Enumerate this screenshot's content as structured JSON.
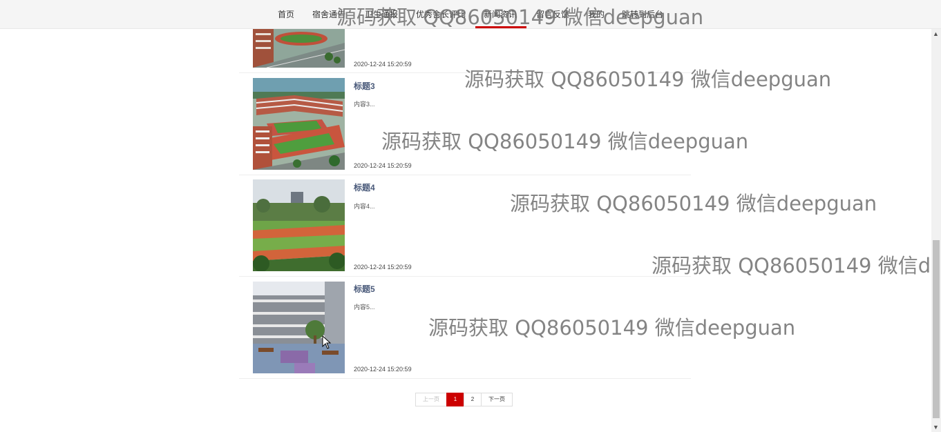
{
  "nav": {
    "items": [
      "首页",
      "宿舍通告",
      "卫生通报",
      "优秀舍长评比",
      "新闻资讯",
      "留言反馈",
      "我的",
      "跳转到后台"
    ],
    "active": "新闻资讯"
  },
  "news": [
    {
      "title": "",
      "summary": "",
      "date": "2020-12-24 15:20:59"
    },
    {
      "title": "标题3",
      "summary": "内容3...",
      "date": "2020-12-24 15:20:59"
    },
    {
      "title": "标题4",
      "summary": "内容4...",
      "date": "2020-12-24 15:20:59"
    },
    {
      "title": "标题5",
      "summary": "内容5...",
      "date": "2020-12-24 15:20:59"
    }
  ],
  "pagination": {
    "prev": "上一页",
    "pages": [
      "1",
      "2"
    ],
    "current": "1",
    "next": "下一页"
  },
  "watermark": "源码获取 QQ86050149 微信deepguan",
  "colors": {
    "accent": "#cc0000",
    "title": "#4a5a7a"
  }
}
